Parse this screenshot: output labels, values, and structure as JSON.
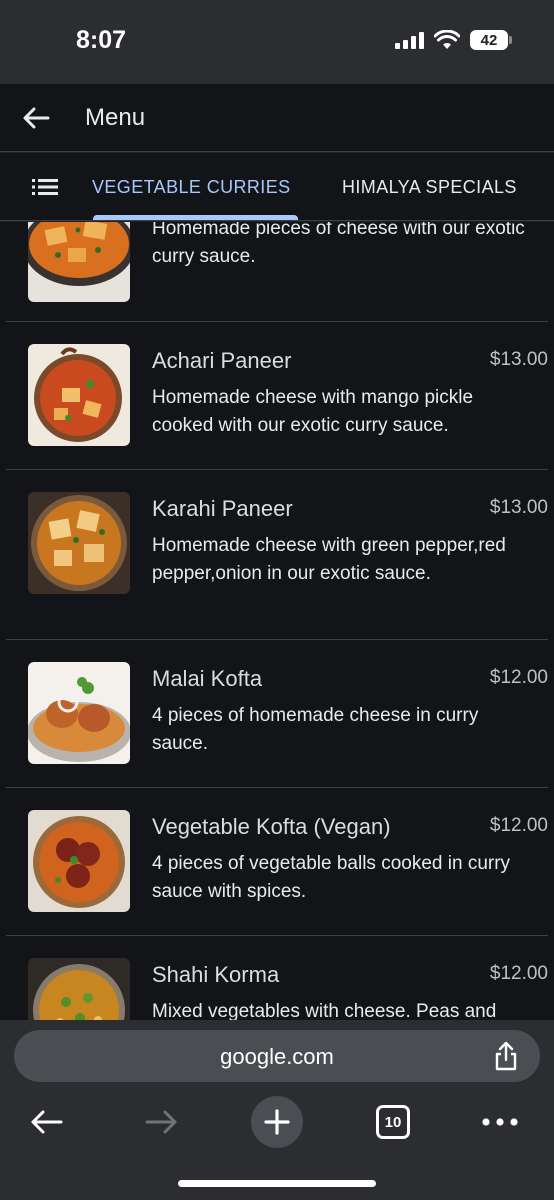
{
  "status_bar": {
    "time": "8:07",
    "battery": "42"
  },
  "app_bar": {
    "title": "Menu"
  },
  "tabs": [
    {
      "label": "VEGETABLE CURRIES",
      "active": true
    },
    {
      "label": "HIMALYA SPECIALS",
      "active": false
    }
  ],
  "items": [
    {
      "name": "",
      "price": "",
      "description": "Homemade pieces of cheese with our exotic curry sauce."
    },
    {
      "name": "Achari Paneer",
      "price": "$13.00",
      "description": "Homemade cheese with mango pickle cooked with our exotic curry sauce."
    },
    {
      "name": "Karahi Paneer",
      "price": "$13.00",
      "description": "Homemade cheese with green pepper,red pepper,onion in our exotic sauce."
    },
    {
      "name": "Malai Kofta",
      "price": "$12.00",
      "description": "4 pieces of homemade cheese in curry sauce."
    },
    {
      "name": "Vegetable Kofta (Vegan)",
      "price": "$12.00",
      "description": "4 pieces of vegetable balls cooked in curry sauce with spices."
    },
    {
      "name": "Shahi Korma",
      "price": "$12.00",
      "description": "Mixed vegetables with cheese. Peas and"
    }
  ],
  "browser": {
    "url": "google.com",
    "tab_count": "10"
  },
  "colors": {
    "accent": "#a8c7fa",
    "background": "#131418",
    "chrome": "#2b2d30"
  }
}
